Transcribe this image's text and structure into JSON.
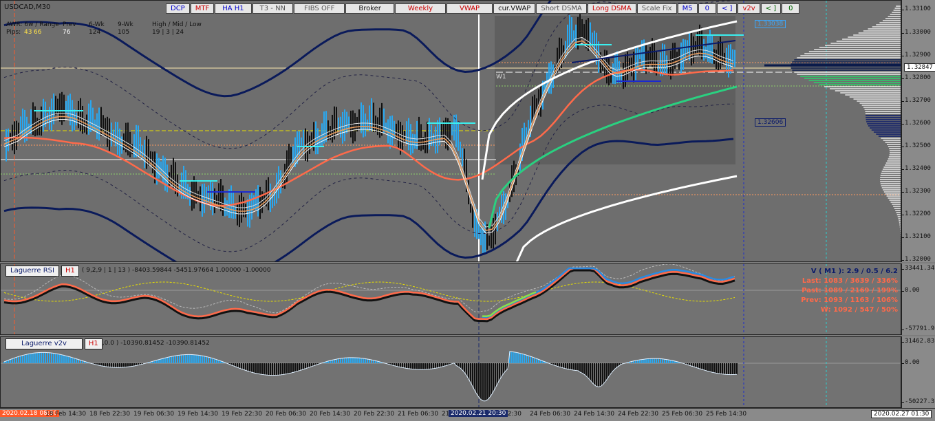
{
  "chart": {
    "symbol_label": "USDCAD,M30",
    "toolbar": [
      {
        "label": "DCP",
        "color": "#0000cc"
      },
      {
        "label": "MTF",
        "color": "#cc0000"
      },
      {
        "label": "HA H1",
        "color": "#0000cc"
      },
      {
        "label": "T3 - NN",
        "color": "#555555"
      },
      {
        "label": "FIBS OFF",
        "color": "#555555"
      },
      {
        "label": "Broker",
        "color": "#111111"
      },
      {
        "label": "Weekly",
        "color": "#cc0000"
      },
      {
        "label": "VWAP",
        "color": "#cc0000"
      },
      {
        "label": "cur.VWAP",
        "color": "#111111"
      },
      {
        "label": "Short DSMA",
        "color": "#555555"
      },
      {
        "label": "Long DSMA",
        "color": "#cc0000"
      },
      {
        "label": "Scale Fix",
        "color": "#555555"
      },
      {
        "label": "M5",
        "color": "#0000cc"
      },
      {
        "label": "0",
        "color": "#0000cc"
      },
      {
        "label": "< ]",
        "color": "#0000cc"
      },
      {
        "label": "v2v",
        "color": "#cc0000"
      },
      {
        "label": "< ]",
        "color": "#006600"
      },
      {
        "label": "0",
        "color": "#006600"
      }
    ],
    "stats": {
      "row1": [
        "AWR: 6w / Range",
        "Prev",
        "6-Wk",
        "9-Wk",
        "High / Mid / Low"
      ],
      "row2_label": "Pips:",
      "row2_values": [
        "43",
        "66",
        "76",
        "124",
        "105",
        "19 | 3 | 24"
      ]
    },
    "week_label": "W1",
    "price_ticks": [
      "1.33100",
      "1.33000",
      "1.32900",
      "1.32800",
      "1.32700",
      "1.32600",
      "1.32500",
      "1.32400",
      "1.32300",
      "1.32200",
      "1.32100",
      "1.32000"
    ],
    "price_tags": {
      "upper": "1.33038",
      "current": "1.32847",
      "lower": "1.32606"
    }
  },
  "rsi": {
    "name": "Laguerre RSI",
    "tf": "H1",
    "params": "( 9,2,9 | 1 | 13 ) -8403.59844 -5451.97664 1.00000 -1.00000",
    "axis_top": "33441.349",
    "axis_mid": "0.00",
    "axis_bottom": "-57791.98",
    "vstats": [
      {
        "text": "V ( M1 ): 2.9 / 0.5 / 6.2",
        "color": "#0a1a6a"
      },
      {
        "text": "Last: 1083 / 3639 / 336%",
        "color": "#ff6a4a"
      },
      {
        "text": "Past: 1089 / 2169 / 199%",
        "color": "#ff6a4a"
      },
      {
        "text": "Prev: 1093 / 1163 / 106%",
        "color": "#ff6a4a"
      },
      {
        "text": "W: 1092 / 547 / 50%",
        "color": "#ff6a4a"
      }
    ]
  },
  "v2v": {
    "name": "Laguerre v2v",
    "tf": "H1",
    "params": ",0.0 ) -10390.81452 -10390.81452",
    "axis_top": "31462.832",
    "axis_mid": "0.00",
    "axis_bottom": "-50227.37"
  },
  "time_axis": {
    "start_tag": "2020.02.18 08:30",
    "labels": [
      "18 Feb 14:30",
      "18 Feb 22:30",
      "19 Feb 06:30",
      "19 Feb 14:30",
      "19 Feb 22:30",
      "20 Feb 06:30",
      "20 Feb 14:30",
      "20 Feb 22:30",
      "21 Feb 06:30",
      "21",
      "22:30",
      "24 Feb 06:30",
      "24 Feb 14:30",
      "24 Feb 22:30",
      "25 Feb 06:30",
      "25 Feb 14:30"
    ],
    "cursor_tag": "2020.02.21 20:30",
    "end_tag": "2020.02.27 01:30"
  }
}
